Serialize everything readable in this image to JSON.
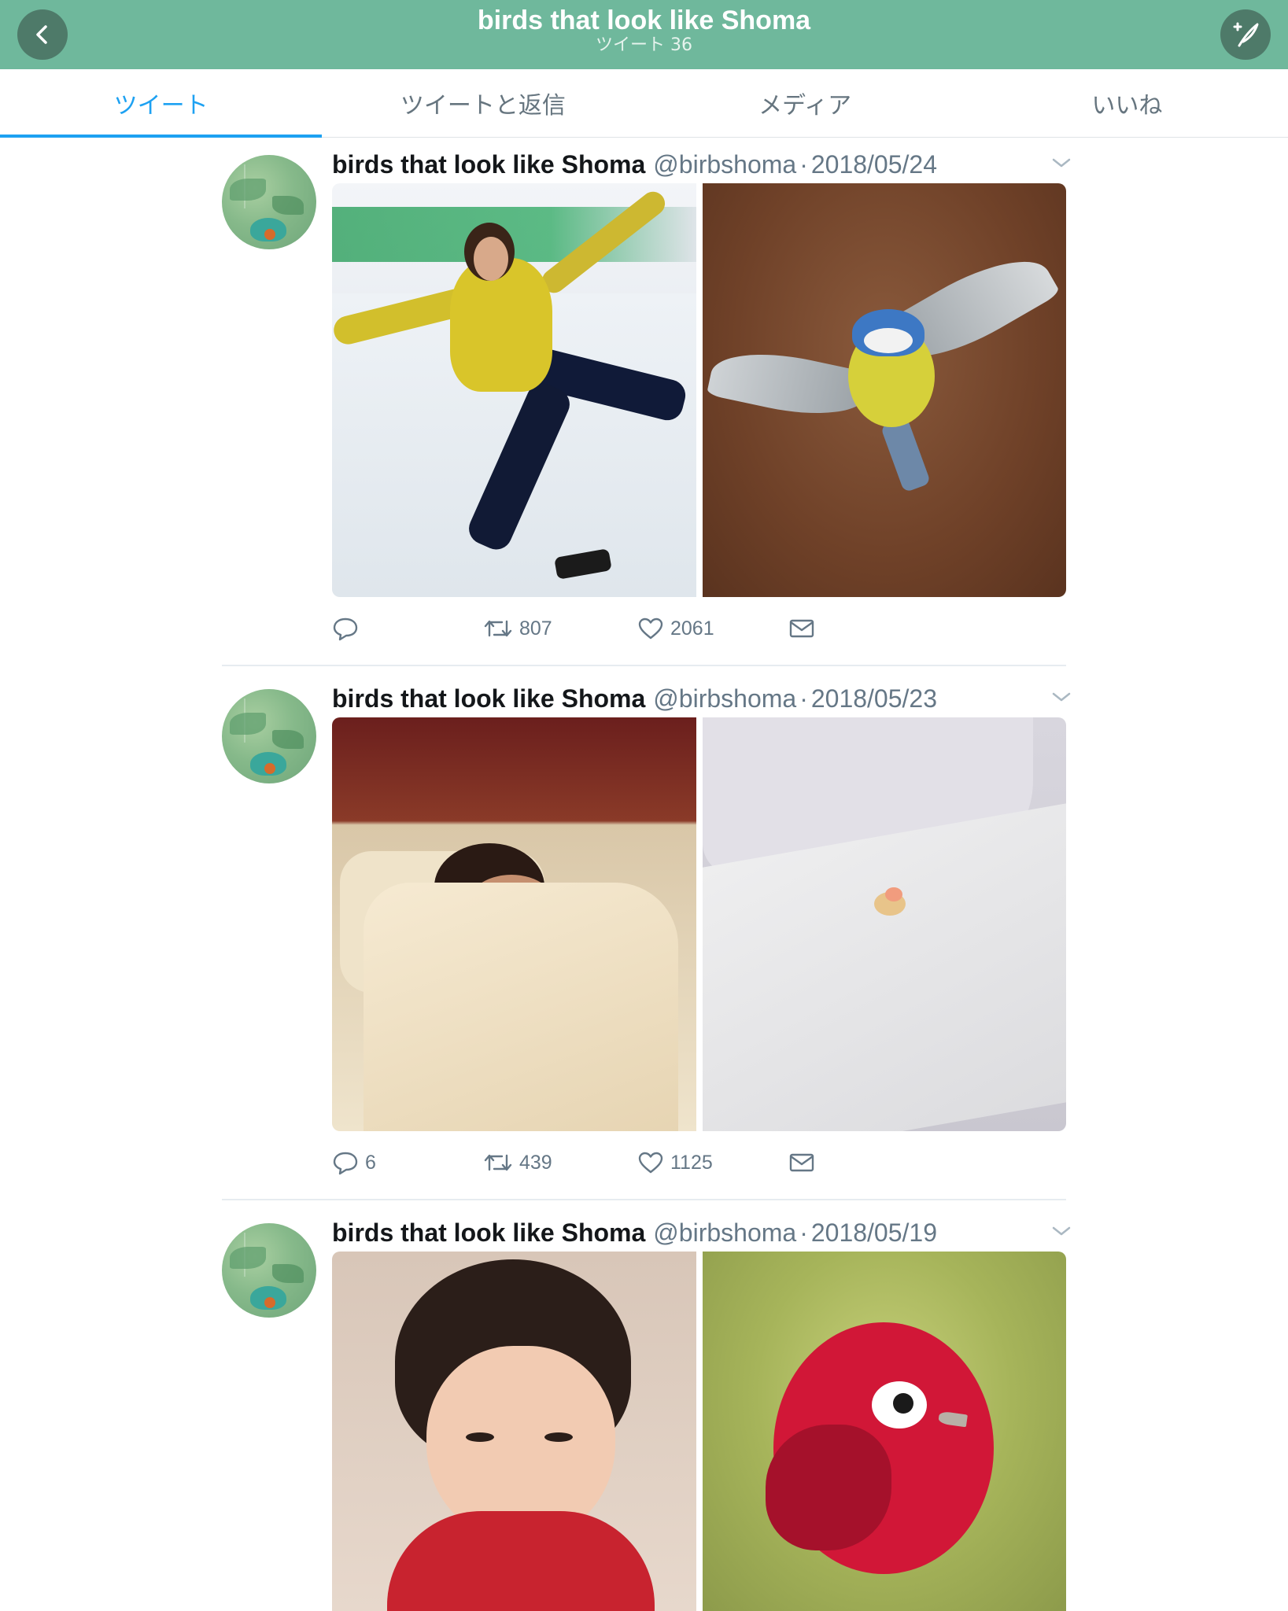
{
  "header": {
    "title": "birds that look like Shoma",
    "subtitle": "ツイート 36"
  },
  "tabs": [
    {
      "label": "ツイート",
      "active": true
    },
    {
      "label": "ツイートと返信",
      "active": false
    },
    {
      "label": "メディア",
      "active": false
    },
    {
      "label": "いいね",
      "active": false
    }
  ],
  "tweets": [
    {
      "name": "birds that look like Shoma",
      "handle": "@birbshoma",
      "separator": "·",
      "date": "2018/05/24",
      "images": [
        "figure-skater-yellow-costume",
        "blue-tit-in-flight"
      ],
      "reply_count": "",
      "retweet_count": "807",
      "like_count": "2061"
    },
    {
      "name": "birds that look like Shoma",
      "handle": "@birbshoma",
      "separator": "·",
      "date": "2018/05/23",
      "images": [
        "person-in-bed",
        "small-bird-in-bedsheets"
      ],
      "reply_count": "6",
      "retweet_count": "439",
      "like_count": "1125"
    },
    {
      "name": "birds that look like Shoma",
      "handle": "@birbshoma",
      "separator": "·",
      "date": "2018/05/19",
      "images": [
        "child-red-sweater",
        "red-bird"
      ],
      "reply_count": "",
      "retweet_count": "",
      "like_count": ""
    }
  ],
  "icons": {
    "back": "chevron-left-icon",
    "compose": "compose-tweet-icon",
    "menu": "chevron-down-icon",
    "reply": "reply-icon",
    "retweet": "retweet-icon",
    "like": "heart-icon",
    "dm": "envelope-icon"
  },
  "colors": {
    "header_bg": "#6fb89c",
    "accent": "#1da1f2",
    "muted": "#657786"
  }
}
